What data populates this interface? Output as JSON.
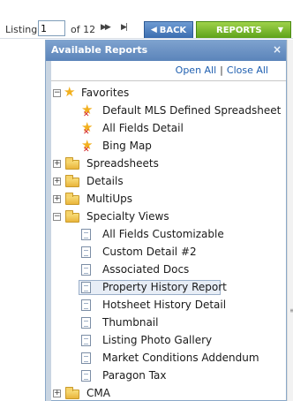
{
  "toolbar": {
    "listing_label": "Listing",
    "page_value": "1",
    "of_label": "of 12",
    "next_icon": "fast-forward-icon",
    "last_icon": "skip-to-end-icon",
    "back_label": "BACK",
    "reports_label": "REPORTS",
    "back_color": "#3b6db0",
    "reports_color": "#5ea21a"
  },
  "panel": {
    "title": "Available Reports",
    "close_glyph": "×",
    "open_all": "Open All",
    "separator": "|",
    "close_all": "Close All"
  },
  "tree": [
    {
      "label": "Favorites",
      "icon": "star-icon",
      "expander": "−"
    },
    {
      "label": "Default MLS Defined Spreadsheet",
      "icon": "favorite-remove-icon"
    },
    {
      "label": "All Fields Detail",
      "icon": "favorite-remove-icon"
    },
    {
      "label": "Bing Map",
      "icon": "favorite-remove-icon"
    },
    {
      "label": "Spreadsheets",
      "icon": "folder-icon",
      "expander": "+"
    },
    {
      "label": "Details",
      "icon": "folder-icon",
      "expander": "+"
    },
    {
      "label": "MultiUps",
      "icon": "folder-icon",
      "expander": "+"
    },
    {
      "label": "Specialty Views",
      "icon": "folder-icon",
      "expander": "−"
    },
    {
      "label": "All Fields Customizable",
      "icon": "document-icon"
    },
    {
      "label": "Custom Detail #2",
      "icon": "document-icon"
    },
    {
      "label": "Associated Docs",
      "icon": "document-icon"
    },
    {
      "label": "Property History Report",
      "icon": "document-icon",
      "selected": true
    },
    {
      "label": "Hotsheet History Detail",
      "icon": "document-icon"
    },
    {
      "label": "Thumbnail",
      "icon": "document-icon"
    },
    {
      "label": "Listing Photo Gallery",
      "icon": "document-icon"
    },
    {
      "label": "Market Conditions Addendum",
      "icon": "document-icon"
    },
    {
      "label": "Paragon Tax",
      "icon": "document-icon"
    },
    {
      "label": "CMA",
      "icon": "folder-icon",
      "expander": "+"
    }
  ]
}
